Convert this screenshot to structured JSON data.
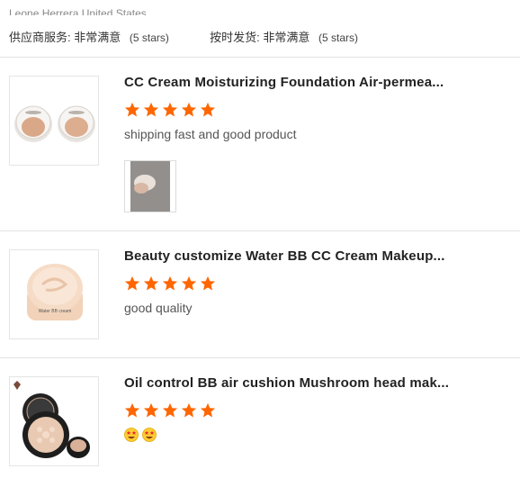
{
  "header": {
    "location": "Leone Herrera,United States",
    "supplier_service_label": "供应商服务:",
    "supplier_service_value": "非常满意",
    "supplier_service_stars": "(5 stars)",
    "ontime_label": "按时发货:",
    "ontime_value": "非常满意",
    "ontime_stars": "(5 stars)"
  },
  "colors": {
    "star": "#ff6600",
    "divider": "#e3e3e3"
  },
  "reviews": [
    {
      "title": "CC Cream Moisturizing Foundation Air-permea...",
      "rating": 5,
      "comment": "shipping fast and good product",
      "has_photo": true
    },
    {
      "title": "Beauty customize Water BB CC Cream Makeup...",
      "rating": 5,
      "comment": "good quality",
      "has_photo": false
    },
    {
      "title": "Oil control BB air cushion Mushroom head mak...",
      "rating": 5,
      "comment": "",
      "emojis": [
        "star-struck-emoji",
        "star-struck-emoji"
      ]
    }
  ]
}
